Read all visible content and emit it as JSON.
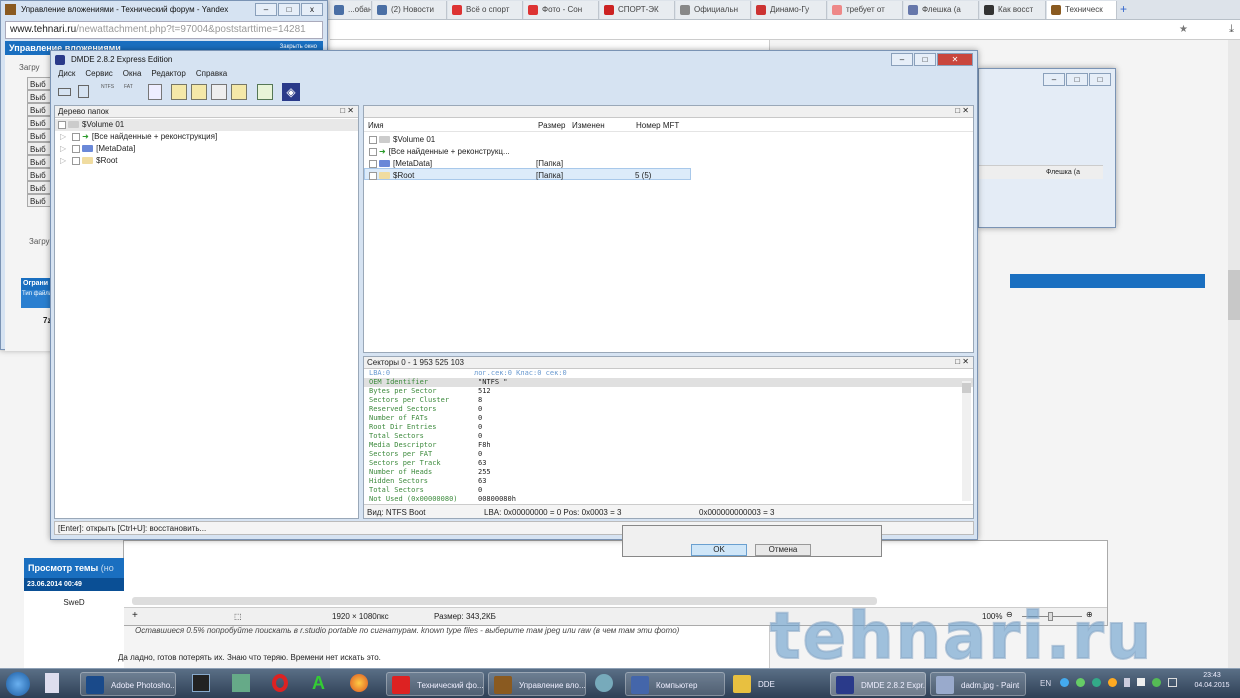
{
  "browser": {
    "tabs": [
      "...обанк",
      "(2) Новости",
      "Всё о спорт",
      "Фото - Сон",
      "СПОРТ-ЭК",
      "Официальн",
      "Динамо-Гу",
      "требует от",
      "Флешка (а",
      "Как восст",
      "Техническ"
    ],
    "popup_title": "Управление вложениями - Технический форум - Yandex",
    "popup_url_host": "www.tehnari.ru",
    "popup_url_path": "/newattachment.php?t=97004&poststarttime=14281",
    "popup_header": "Управление вложениями",
    "popup_close_link": "Закрыть окно",
    "upload_group": "Загру",
    "choose_btn": "Выб",
    "limits_header": "Ограни",
    "type_label": "Тип файла",
    "file_item": "7z"
  },
  "dmde": {
    "title": "DMDE 2.8.2 Express Edition",
    "menu": [
      "Диск",
      "Сервис",
      "Окна",
      "Редактор",
      "Справка"
    ],
    "toolbar": {
      "ntfs": "NTFS",
      "fat": "FAT"
    },
    "tree": {
      "header": "Дерево папок",
      "items": [
        "$Volume 01",
        "[Все найденные + реконструкция]",
        "[MetaData]",
        "$Root"
      ]
    },
    "list": {
      "columns": [
        "Имя",
        "Размер",
        "Изменен",
        "Номер MFT"
      ],
      "rows": [
        {
          "name": "$Volume 01",
          "size": "",
          "mft": ""
        },
        {
          "name": "[Все найденные + реконструкц...",
          "size": "",
          "mft": ""
        },
        {
          "name": "[MetaData]",
          "size": "[Папка]",
          "mft": ""
        },
        {
          "name": "$Root",
          "size": "[Папка]",
          "mft": "5 (5)"
        }
      ]
    },
    "sectors": {
      "header": "Секторы 0 - 1 953 525 103",
      "top_left": "LBA:0",
      "top_right": "лог.сек:0 Клас:0 сек:0",
      "rows": [
        [
          "OEM Identifier",
          "\"NTFS    \""
        ],
        [
          "Bytes per Sector",
          "512"
        ],
        [
          "Sectors per Cluster",
          "8"
        ],
        [
          "Reserved Sectors",
          "0"
        ],
        [
          "Number of FATs",
          "0"
        ],
        [
          "Root Dir Entries",
          "0"
        ],
        [
          "Total Sectors",
          "0"
        ],
        [
          "Media Descriptor",
          "F8h"
        ],
        [
          "Sectors per FAT",
          "0"
        ],
        [
          "Sectors per Track",
          "63"
        ],
        [
          "Number of Heads",
          "255"
        ],
        [
          "Hidden Sectors",
          "63"
        ],
        [
          "Total Sectors",
          "0"
        ],
        [
          "Not Used (0x00000080)",
          "00800080h"
        ]
      ],
      "status_view": "Вид: NTFS Boot",
      "status_lba": "LBA: 0x00000000 = 0  Pos: 0x0003 = 3",
      "status_off": "0x000000000003 = 3"
    },
    "status": "[Enter]: открыть  [Ctrl+U]: восстановить..."
  },
  "paint": {
    "dims": "1920 × 1080пкс",
    "size": "Размер: 343,2КБ",
    "zoom": "100%",
    "ok": "OK",
    "cancel": "Отмена"
  },
  "forum": {
    "view_header": "Просмотр темы",
    "view_header_extra": "(но",
    "date": "23.06.2014 00:49",
    "user": "SweD",
    "quote": "Оставшиеся 0.5% попробуйте поискать в r.studio portable по сигнатурам. known type files - выберите там jpeg или raw (в чем там эти фото)",
    "reply": "Да ладно, готов потерять их. Знаю что теряю. Времени нет искать это."
  },
  "watermark": "tehnari.ru",
  "taskbar": {
    "items": [
      "Adobe Photosho...",
      "Технический фо...",
      "Управление вло...",
      "Компьютер",
      "DDE",
      "DMDE 2.8.2 Expr...",
      "dadm.jpg - Paint"
    ],
    "lang": "EN",
    "time": "23:43",
    "date": "04.04.2015"
  }
}
